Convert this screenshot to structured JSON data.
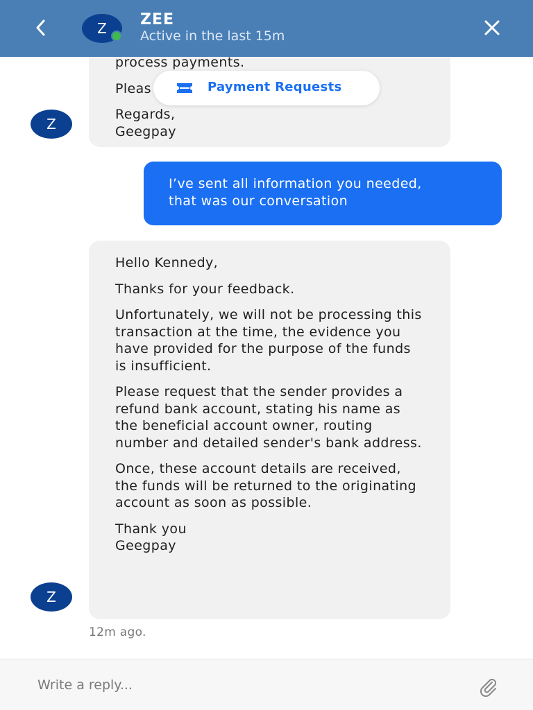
{
  "header": {
    "back_glyph": "‹",
    "avatar_initial": "Z",
    "name": "ZEE",
    "status": "Active in the last 15m",
    "close_glyph": "✕",
    "online_color": "#3fb950"
  },
  "payment_pill": {
    "label": "Payment Requests",
    "icon": "ticket-icon"
  },
  "messages": {
    "m1": {
      "sender": "contact",
      "avatar_initial": "Z",
      "lines": [
        "process payments.",
        "Pleas",
        "Regards,",
        "Geegpay"
      ]
    },
    "m2": {
      "sender": "me",
      "text_line1": "I’ve sent all information you needed,",
      "text_line2": "that was our conversation"
    },
    "m3": {
      "sender": "contact",
      "avatar_initial": "Z",
      "greeting": "Hello Kennedy,",
      "p1": "Thanks for your feedback.",
      "p2": "Unfortunately, we will not be processing this transaction at the time, the evidence you have provided for the purpose of the funds is insufficient.",
      "p3": "Please request that the sender provides a refund bank account, stating his name as the beneficial account owner, routing number and detailed sender's bank address.",
      "p4": "Once, these account details are received, the funds will be returned to the originating account as soon as possible.",
      "sign1": "Thank you",
      "sign2": "Geegpay",
      "timestamp": "12m ago."
    }
  },
  "reply": {
    "placeholder": "Write a reply...",
    "attach_icon": "paperclip-icon"
  },
  "colors": {
    "header_bg": "#4a7fb6",
    "accent": "#1a6ff2",
    "avatar_bg": "#0b3f8f",
    "incoming_bubble": "#f1f1f1"
  }
}
